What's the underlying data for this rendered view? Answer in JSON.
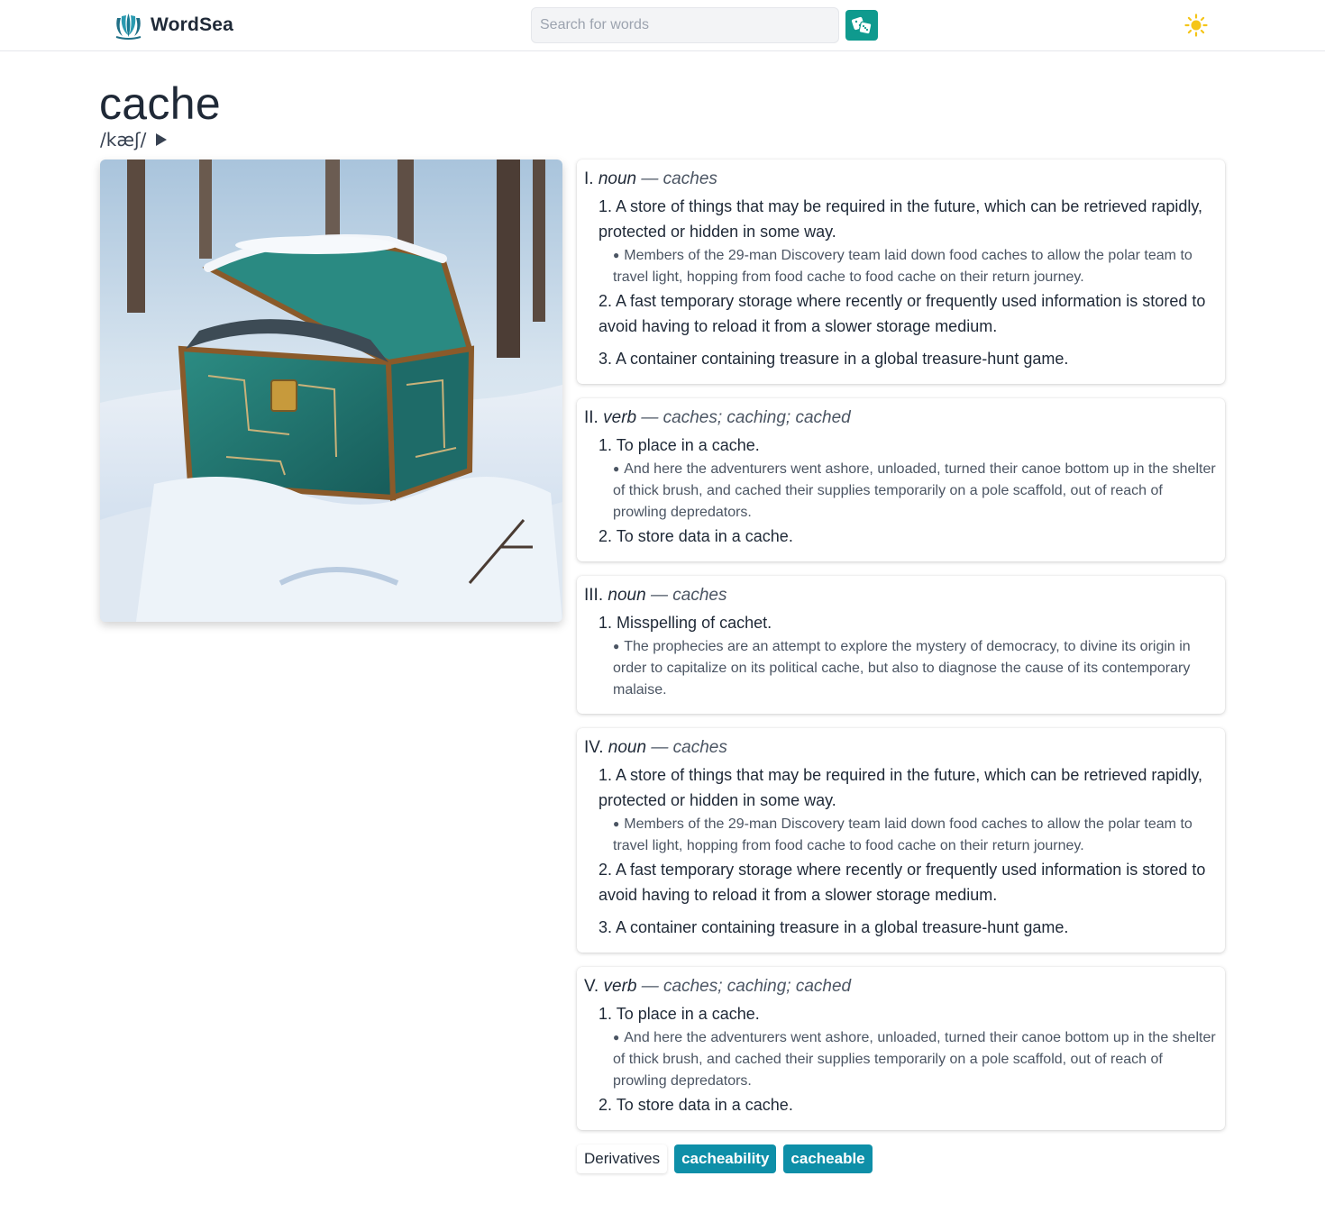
{
  "header": {
    "app_name": "WordSea",
    "search_placeholder": "Search for words",
    "search_value": ""
  },
  "entry": {
    "word": "cache",
    "pronunciation": "/kæʃ/"
  },
  "definitions": [
    {
      "numeral": "I.",
      "pos": "noun",
      "forms": "— caches",
      "senses": [
        {
          "n": "1.",
          "text": "A store of things that may be required in the future, which can be retrieved rapidly, protected or hidden in some way.",
          "example": "Members of the 29-man Discovery team laid down food caches to allow the polar team to travel light, hopping from food cache to food cache on their return journey."
        },
        {
          "n": "2.",
          "text": "A fast temporary storage where recently or frequently used information is stored to avoid having to reload it from a slower storage medium.",
          "example": ""
        },
        {
          "n": "3.",
          "text": "A container containing treasure in a global treasure-hunt game.",
          "example": ""
        }
      ]
    },
    {
      "numeral": "II.",
      "pos": "verb",
      "forms": "— caches; caching; cached",
      "senses": [
        {
          "n": "1.",
          "text": "To place in a cache.",
          "example": "And here the adventurers went ashore, unloaded, turned their canoe bottom up in the shelter of thick brush, and cached their supplies temporarily on a pole scaffold, out of reach of prowling depredators."
        },
        {
          "n": "2.",
          "text": "To store data in a cache.",
          "example": ""
        }
      ]
    },
    {
      "numeral": "III.",
      "pos": "noun",
      "forms": "— caches",
      "senses": [
        {
          "n": "1.",
          "text": "Misspelling of cachet.",
          "example": "The prophecies are an attempt to explore the mystery of democracy, to divine its origin in order to capitalize on its political cache, but also to diagnose the cause of its contemporary malaise."
        }
      ]
    },
    {
      "numeral": "IV.",
      "pos": "noun",
      "forms": "— caches",
      "senses": [
        {
          "n": "1.",
          "text": "A store of things that may be required in the future, which can be retrieved rapidly, protected or hidden in some way.",
          "example": "Members of the 29-man Discovery team laid down food caches to allow the polar team to travel light, hopping from food cache to food cache on their return journey."
        },
        {
          "n": "2.",
          "text": "A fast temporary storage where recently or frequently used information is stored to avoid having to reload it from a slower storage medium.",
          "example": ""
        },
        {
          "n": "3.",
          "text": "A container containing treasure in a global treasure-hunt game.",
          "example": ""
        }
      ]
    },
    {
      "numeral": "V.",
      "pos": "verb",
      "forms": "— caches; caching; cached",
      "senses": [
        {
          "n": "1.",
          "text": "To place in a cache.",
          "example": "And here the adventurers went ashore, unloaded, turned their canoe bottom up in the shelter of thick brush, and cached their supplies temporarily on a pole scaffold, out of reach of prowling depredators."
        },
        {
          "n": "2.",
          "text": "To store data in a cache.",
          "example": ""
        }
      ]
    }
  ],
  "derivatives": {
    "label": "Derivatives",
    "items": [
      "cacheability",
      "cacheable"
    ]
  },
  "icons": {
    "logo": "wave-logo-icon",
    "random": "dice-icon",
    "theme": "sun-icon",
    "audio": "play-icon"
  },
  "colors": {
    "accent": "#0f9a8e",
    "chip": "#0e8fa8",
    "sun": "#f5c518"
  }
}
